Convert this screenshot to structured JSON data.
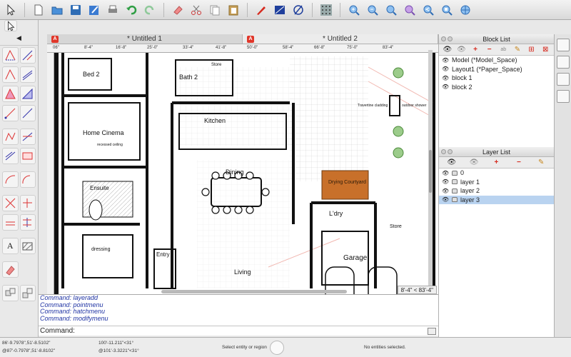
{
  "toolbar": {
    "icons": [
      "select-arrow-icon",
      "new-document-icon",
      "open-folder-icon",
      "save-icon",
      "edit-icon",
      "print-icon",
      "undo-icon",
      "redo-icon",
      "eraser-icon",
      "cut-icon",
      "copy-icon",
      "paste-icon",
      "pencil-icon",
      "area-icon",
      "circle-slash-icon",
      "grid-icon",
      "zoom-in-icon",
      "zoom-out-icon",
      "zoom-fit-icon",
      "zoom-window-icon",
      "zoom-previous-icon",
      "zoom-extents-icon",
      "pan-icon"
    ]
  },
  "tabs": [
    {
      "label": "* Untitled 1",
      "active": false
    },
    {
      "label": "* Untitled 2",
      "active": true
    }
  ],
  "ruler": {
    "marks": [
      "06\"",
      "8'-4\"",
      "16'-8\"",
      "25'-0\"",
      "33'-4\"",
      "25'-0\"",
      "41'-8\"",
      "50'-0\"",
      "58'-4\"",
      "66'-8\"",
      "75'-0\"",
      "83'-4\""
    ]
  },
  "plan": {
    "rooms": [
      "Bed 2",
      "Bath 2",
      "Store",
      "Home Cinema",
      "recessed ceiling",
      "Kitchen",
      "Dining",
      "Ensuite",
      "dressing",
      "Entry",
      "Living",
      "L'dry",
      "Store",
      "Drying Courtyard",
      "Garage",
      "Travertine cladding",
      "outdoor shower"
    ],
    "courtyard_label": "Drying\nCourtyard",
    "courtyard_color": "#c8702a"
  },
  "coord_readout": "8'-4\" < 83'-4\"",
  "command": {
    "lines": [
      {
        "k": "Command:",
        "v": "layeradd"
      },
      {
        "k": "Command:",
        "v": "pointmenu"
      },
      {
        "k": "Command:",
        "v": "hatchmenu"
      },
      {
        "k": "Command:",
        "v": "modifymenu"
      }
    ],
    "prompt_label": "Command:"
  },
  "block_list": {
    "title": "Block List",
    "items": [
      "Model (*Model_Space)",
      "Layout1 (*Paper_Space)",
      "block 1",
      "block 2"
    ]
  },
  "layer_list": {
    "title": "Layer List",
    "items": [
      {
        "name": "0",
        "selected": false
      },
      {
        "name": "layer 1",
        "selected": false
      },
      {
        "name": "layer 2",
        "selected": false
      },
      {
        "name": "layer 3",
        "selected": true
      }
    ]
  },
  "status": {
    "coord1": "86'-9.7978\",51'-8.5102\"",
    "coord2": "@87'-0.7978\",51'-8.8102\"",
    "coord3": "100'-11.211\"<31°",
    "coord4": "@101'-3.3221\"<31°",
    "hint": "Select entity or region",
    "selection": "No entities selected."
  },
  "colors": {
    "accent": "#1f33a3",
    "selection": "#b9d3f0",
    "red_button": "#d62b1f"
  }
}
